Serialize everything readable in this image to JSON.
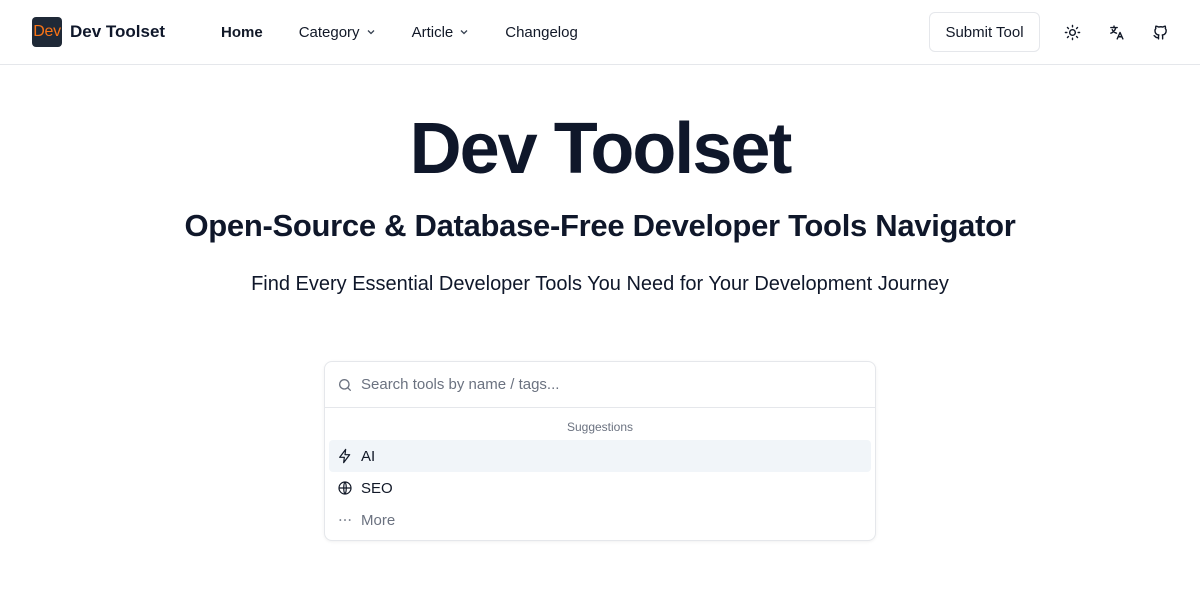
{
  "header": {
    "logo_badge": "Dev",
    "logo_text": "Dev Toolset",
    "nav": [
      {
        "label": "Home",
        "active": true,
        "dropdown": false
      },
      {
        "label": "Category",
        "active": false,
        "dropdown": true
      },
      {
        "label": "Article",
        "active": false,
        "dropdown": true
      },
      {
        "label": "Changelog",
        "active": false,
        "dropdown": false
      }
    ],
    "submit_label": "Submit Tool",
    "icons": [
      "sun-icon",
      "translate-icon",
      "github-icon"
    ]
  },
  "hero": {
    "title": "Dev Toolset",
    "subtitle": "Open-Source & Database-Free Developer Tools Navigator",
    "description": "Find Every Essential Developer Tools You Need for Your Development Journey"
  },
  "search": {
    "placeholder": "Search tools by name / tags...",
    "value": "",
    "suggestions_heading": "Suggestions",
    "suggestions": [
      {
        "label": "AI",
        "icon": "lightning-icon",
        "selected": true
      },
      {
        "label": "SEO",
        "icon": "globe-icon",
        "selected": false
      },
      {
        "label": "More",
        "icon": "more-dots-icon",
        "selected": false
      }
    ]
  },
  "colors": {
    "text": "#0f172a",
    "muted": "#6b7280",
    "border": "#e5e7eb",
    "logo_badge_bg": "#1f2937",
    "logo_badge_text": "#f97316",
    "selected_bg": "#f1f5f9"
  }
}
